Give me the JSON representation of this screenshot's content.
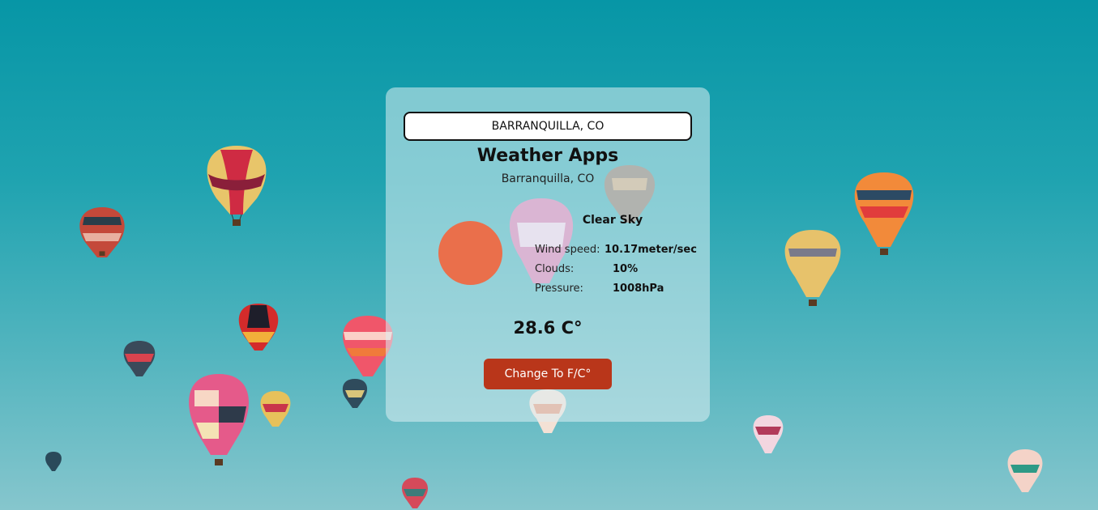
{
  "search": {
    "value": "BARRANQUILLA, CO"
  },
  "app": {
    "title": "Weather Apps",
    "location": "Barranquilla, CO"
  },
  "weather": {
    "icon": "sun-icon",
    "condition": "Clear Sky",
    "stats": [
      {
        "label": "Wind speed:",
        "value": "10.17meter/sec"
      },
      {
        "label": "Clouds:",
        "value": "10%"
      },
      {
        "label": "Pressure:",
        "value": "1008hPa"
      }
    ],
    "temperature": "28.6 C°"
  },
  "actions": {
    "toggle_unit_label": "Change To F/C°"
  },
  "colors": {
    "sky_top": "#0796a6",
    "sky_bottom": "#86c6cd",
    "sun": "#ea6f4b",
    "button": "#b9361a"
  }
}
